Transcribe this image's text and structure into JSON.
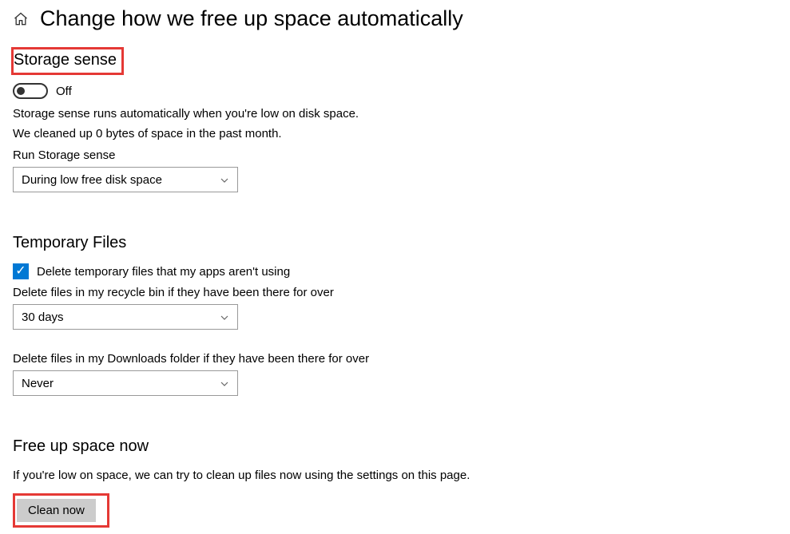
{
  "header": {
    "title": "Change how we free up space automatically"
  },
  "storage_sense": {
    "heading": "Storage sense",
    "toggle_state": "Off",
    "description_line1": "Storage sense runs automatically when you're low on disk space.",
    "description_line2": "We cleaned up 0 bytes of space in the past month.",
    "run_label": "Run Storage sense",
    "run_value": "During low free disk space"
  },
  "temp_files": {
    "heading": "Temporary Files",
    "checkbox_label": "Delete temporary files that my apps aren't using",
    "recycle_label": "Delete files in my recycle bin if they have been there for over",
    "recycle_value": "30 days",
    "downloads_label": "Delete files in my Downloads folder if they have been there for over",
    "downloads_value": "Never"
  },
  "free_up": {
    "heading": "Free up space now",
    "description": "If you're low on space, we can try to clean up files now using the settings on this page.",
    "button_label": "Clean now"
  }
}
